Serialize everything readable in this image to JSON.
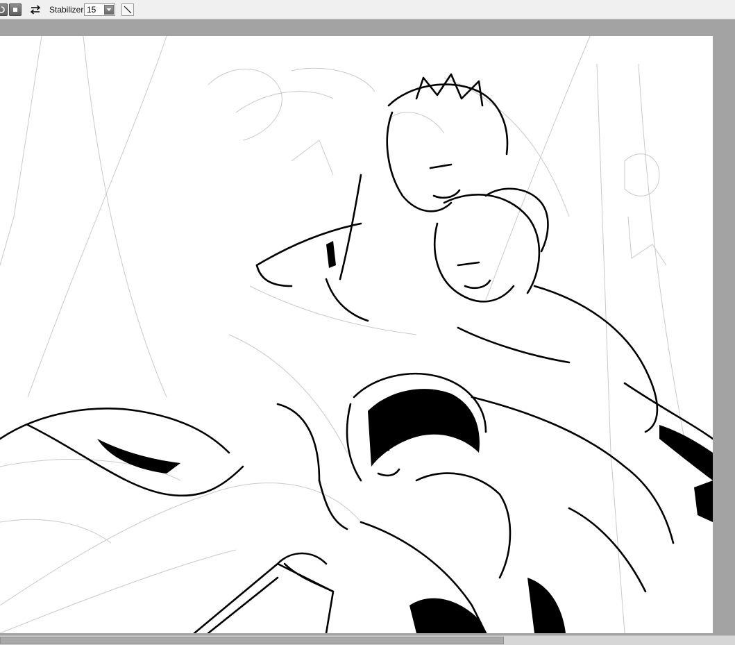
{
  "toolbar": {
    "rotate_icon": "rotate-icon",
    "stop_icon": "stop-square-icon",
    "flip_icon": "flip-horizontal-icon",
    "stabilizer_label": "Stabilizer",
    "stabilizer_value": "15",
    "dropdown_icon": "chevron-down-icon",
    "line_tool_icon": "line-tool-icon"
  },
  "colors": {
    "workspace": "#a3a3a3",
    "toolbar": "#f0f0f0",
    "canvas": "#ffffff"
  }
}
